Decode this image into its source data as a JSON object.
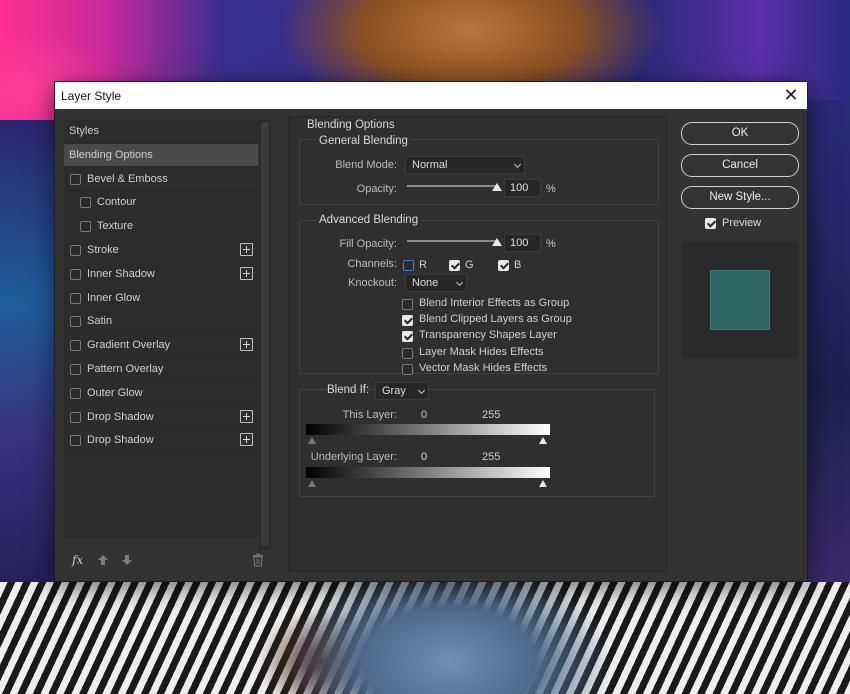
{
  "window": {
    "title": "Layer Style",
    "close_glyph": "✕"
  },
  "sidebar": {
    "items": [
      {
        "label": "Styles",
        "kind": "header"
      },
      {
        "label": "Blending Options",
        "kind": "selected"
      },
      {
        "label": "Bevel & Emboss",
        "checked": false,
        "add": false
      },
      {
        "label": "Contour",
        "checked": false,
        "add": false,
        "indent": true
      },
      {
        "label": "Texture",
        "checked": false,
        "add": false,
        "indent": true
      },
      {
        "label": "Stroke",
        "checked": false,
        "add": true
      },
      {
        "label": "Inner Shadow",
        "checked": false,
        "add": true
      },
      {
        "label": "Inner Glow",
        "checked": false,
        "add": false
      },
      {
        "label": "Satin",
        "checked": false,
        "add": false
      },
      {
        "label": "Gradient Overlay",
        "checked": false,
        "add": true
      },
      {
        "label": "Pattern Overlay",
        "checked": false,
        "add": false
      },
      {
        "label": "Outer Glow",
        "checked": false,
        "add": false
      },
      {
        "label": "Drop Shadow",
        "checked": false,
        "add": true
      },
      {
        "label": "Drop Shadow",
        "checked": false,
        "add": true
      }
    ],
    "footer": {
      "fx_label": "fx",
      "icons": [
        "arrow-up-icon",
        "arrow-down-icon",
        "trash-icon"
      ]
    }
  },
  "blending": {
    "section_title": "Blending Options",
    "general": {
      "title": "General Blending",
      "blend_mode_label": "Blend Mode:",
      "blend_mode_value": "Normal",
      "opacity_label": "Opacity:",
      "opacity_value": "100",
      "opacity_unit": "%",
      "opacity_level": 1.0
    },
    "advanced": {
      "title": "Advanced Blending",
      "fill_opacity_label": "Fill Opacity:",
      "fill_opacity_value": "100",
      "fill_opacity_unit": "%",
      "fill_opacity_level": 1.0,
      "channels_label": "Channels:",
      "channels": [
        {
          "label": "R",
          "checked": false
        },
        {
          "label": "G",
          "checked": true
        },
        {
          "label": "B",
          "checked": true
        }
      ],
      "knockout_label": "Knockout:",
      "knockout_value": "None",
      "options": [
        {
          "label": "Blend Interior Effects as Group",
          "checked": false
        },
        {
          "label": "Blend Clipped Layers as Group",
          "checked": true
        },
        {
          "label": "Transparency Shapes Layer",
          "checked": true
        },
        {
          "label": "Layer Mask Hides Effects",
          "checked": false
        },
        {
          "label": "Vector Mask Hides Effects",
          "checked": false
        }
      ]
    },
    "blend_if": {
      "label": "Blend If:",
      "value": "Gray",
      "this_layer": {
        "label": "This Layer:",
        "low": "0",
        "high": "255"
      },
      "underlying_layer": {
        "label": "Underlying Layer:",
        "low": "0",
        "high": "255"
      }
    }
  },
  "buttons": {
    "ok": "OK",
    "cancel": "Cancel",
    "new_style": "New Style...",
    "preview_label": "Preview",
    "preview_checked": true
  },
  "colors": {
    "dialog_bg": "#323232",
    "selected_row": "#4a4a4a",
    "preview_swatch": "#2f6663"
  }
}
